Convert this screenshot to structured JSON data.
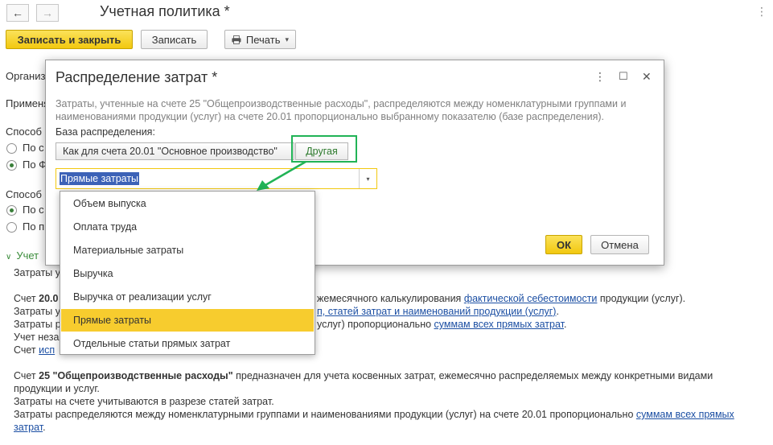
{
  "window": {
    "title": "Учетная политика *",
    "back_icon": "←",
    "forward_icon": "→",
    "more_icon": "⋮"
  },
  "toolbar": {
    "save_close_label": "Записать и закрыть",
    "save_label": "Записать",
    "print_label": "Печать",
    "print_arrow": "▾"
  },
  "background": {
    "org_label": "Организ",
    "apply_label": "Применя",
    "method1_label": "Способ",
    "method1_opt1": "По с",
    "method1_opt2": "По Ф",
    "method2_label": "Способ",
    "method2_opt1": "По с",
    "method2_opt2": "По п",
    "section_toggle": "Учет",
    "lines": {
      "l1": "Затраты у",
      "l2a": "Счет ",
      "l2b": "20.0",
      "l2c": "жемесячного калькулирования ",
      "l2link": "фактической себестоимости",
      "l2d": " продукции (услуг).",
      "l3a": "Затраты у",
      "l3link": "п, статей затрат и наименований продукции (услуг)",
      "l3b": ".",
      "l4a": "Затраты р",
      "l4b": "услуг) пропорционально ",
      "l4link": "суммам всех прямых затрат",
      "l4c": ".",
      "l5": "Учет неза",
      "l6a": "Счет ",
      "l6link": "исп",
      "p2_l1a": "Счет ",
      "p2_l1b": "25 \"Общепроизводственные расходы\"",
      "p2_l1c": " предназначен для учета косвенных затрат, ежемесячно распределяемых между конкретными видами",
      "p2_l2": "продукции и услуг.",
      "p2_l3": "Затраты на счете учитываются в разрезе статей затрат.",
      "p2_l4a": "Затраты распределяются между номенклатурными группами и наименованиями продукции (услуг) на счете 20.01 пропорционально ",
      "p2_l4link": "суммам всех прямых",
      "p2_l5link": "затрат",
      "p2_l5b": "."
    }
  },
  "dialog": {
    "title": "Распределение затрат *",
    "more_icon": "⋮",
    "maximize_icon": "☐",
    "close_icon": "✕",
    "hint_line1": "Затраты, учтенные на счете 25 \"Общепроизводственные расходы\", распределяются между номенклатурными группами и",
    "hint_line2": "наименованиями продукции (услуг) на счете 20.01 пропорционально выбранному показателю (базе распределения).",
    "base_label": "База распределения:",
    "option_same": "Как для счета 20.01 \"Основное производство\"",
    "option_other": "Другая",
    "combo_value": "Прямые затраты",
    "combo_arrow": "▾",
    "ok_label": "ОК",
    "cancel_label": "Отмена"
  },
  "dropdown": {
    "items": [
      "Объем выпуска",
      "Оплата труда",
      "Материальные затраты",
      "Выручка",
      "Выручка от реализации услуг",
      "Прямые затраты",
      "Отдельные статьи прямых затрат"
    ],
    "selected": "Прямые затраты"
  },
  "colors": {
    "accent_yellow": "#f2c80f",
    "annotation_green": "#21b356",
    "link_blue": "#1c4fa3",
    "selection_blue": "#3c62b7"
  }
}
